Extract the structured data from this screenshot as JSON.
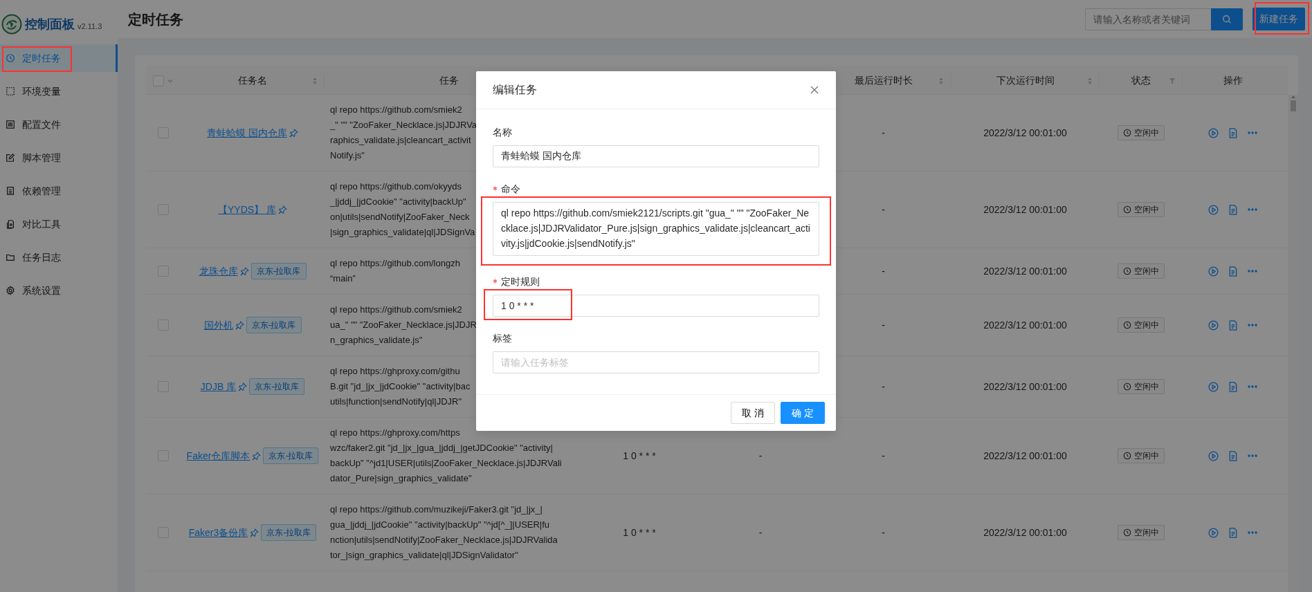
{
  "sidebar": {
    "logo_text": "控制面板",
    "version": "v2.11.3",
    "items": [
      {
        "label": "定时任务",
        "selected": true,
        "highlighted": true
      },
      {
        "label": "环境变量",
        "selected": false,
        "highlighted": false
      },
      {
        "label": "配置文件",
        "selected": false,
        "highlighted": false
      },
      {
        "label": "脚本管理",
        "selected": false,
        "highlighted": false
      },
      {
        "label": "依赖管理",
        "selected": false,
        "highlighted": false
      },
      {
        "label": "对比工具",
        "selected": false,
        "highlighted": false
      },
      {
        "label": "任务日志",
        "selected": false,
        "highlighted": false
      },
      {
        "label": "系统设置",
        "selected": false,
        "highlighted": false
      }
    ]
  },
  "header": {
    "title": "定时任务",
    "search": {
      "placeholder": "请输入名称或者关键词"
    },
    "new_button": {
      "label": "新建任务",
      "highlighted": true
    }
  },
  "table": {
    "select_all": {
      "checked": false
    },
    "columns": [
      {
        "label": "任务名",
        "sortable": true,
        "filterable": false
      },
      {
        "label": "任务",
        "sortable": false,
        "filterable": false
      },
      {
        "label": "最后运行时长",
        "sortable": true,
        "filterable": false
      },
      {
        "label": "下次运行时间",
        "sortable": true,
        "filterable": false
      },
      {
        "label": "状态",
        "sortable": false,
        "filterable": true
      },
      {
        "label": "操作",
        "sortable": false,
        "filterable": false
      }
    ],
    "rows": [
      {
        "checked": false,
        "name": "青蛙蛤蟆 国内仓库",
        "pinned": true,
        "command_lines": [
          "ql repo https://github.com/smiek2",
          "_\" \"\" \"ZooFaker_Necklace.js|JDJRVa",
          "raphics_validate.js|cleancart_activit",
          "Notify.js\""
        ],
        "last_duration": "-",
        "next_run": "2022/3/12 00:01:00",
        "status": "空闲中"
      },
      {
        "checked": false,
        "name": "【YYDS】 库",
        "pinned": true,
        "command_lines": [
          "ql repo https://github.com/okyyds",
          "_|jddj_|jdCookie\" \"activity|backUp\"",
          "on|utils|sendNotify|ZooFaker_Neck",
          "|sign_graphics_validate|ql|JDSignVa"
        ],
        "last_duration": "-",
        "next_run": "2022/3/12 00:01:00",
        "status": "空闲中"
      },
      {
        "checked": false,
        "name": "龙珠仓库",
        "pinned": true,
        "tag": "京东-拉取库",
        "command_lines": [
          "ql repo https://github.com/longzh",
          "“main”"
        ],
        "last_duration": "-",
        "next_run": "2022/3/12 00:01:00",
        "status": "空闲中"
      },
      {
        "checked": false,
        "name": "国外机",
        "pinned": true,
        "tag": "京东-拉取库",
        "command_lines": [
          "ql repo https://github.com/smiek2",
          "ua_\" \"\" \"ZooFaker_Necklace.js|JDJR",
          "n_graphics_validate.js\""
        ],
        "last_duration": "-",
        "next_run": "2022/3/12 00:01:00",
        "status": "空闲中"
      },
      {
        "checked": false,
        "name": "JDJB 库",
        "pinned": true,
        "tag": "京东-拉取库",
        "command_lines": [
          "ql repo https://ghproxy.com/githu",
          "B.git \"jd_|jx_|jdCookie\" \"activity|bac",
          "utils|function|sendNotify|ql|JDJR\""
        ],
        "last_duration": "-",
        "next_run": "2022/3/12 00:01:00",
        "status": "空闲中"
      },
      {
        "checked": false,
        "name": "Faker仓库脚本",
        "pinned": true,
        "tag": "京东-拉取库",
        "command_lines": [
          "ql repo https://ghproxy.com/https",
          "wzc/faker2.git \"jd_|jx_|gua_|jddj_|getJDCookie\" \"activity|",
          "backUp\" \"^jd1|USER|utils|ZooFaker_Necklace.js|JDJRVali",
          "dator_Pure|sign_graphics_validate\""
        ],
        "schedule": "1 0 * * *",
        "column_5": "-",
        "last_duration": "-",
        "next_run": "2022/3/12 00:01:00",
        "status": "空闲中"
      },
      {
        "checked": false,
        "name": "Faker3备份库",
        "pinned": true,
        "tag": "京东-拉取库",
        "command_lines": [
          "ql repo https://github.com/muzikeji/Faker3.git \"jd_|jx_|",
          "gua_|jddj_|jdCookie\" \"activity|backUp\" \"^jd[^_]|USER|fu",
          "nction|utils|sendNotify|ZooFaker_Necklace.js|JDJRValida",
          "tor_|sign_graphics_validate|ql|JDSignValidator\""
        ],
        "schedule": "1 0 * * *",
        "column_5": "-",
        "last_duration": "-",
        "next_run": "2022/3/12 00:01:00",
        "status": "空闲中"
      }
    ]
  },
  "modal": {
    "title": "编辑任务",
    "fields": [
      {
        "kind": "input",
        "label": "名称",
        "required": false,
        "highlighted": false,
        "value": "青蛙蛤蟆 国内仓库"
      },
      {
        "kind": "textarea",
        "label": "命令",
        "required": true,
        "highlighted": true,
        "value": "ql repo https://github.com/smiek2121/scripts.git \"gua_\" \"\" \"ZooFaker_Necklace.js|JDJRValidator_Pure.js|sign_graphics_validate.js|cleancart_activity.js|jdCookie.js|sendNotify.js\""
      },
      {
        "kind": "input",
        "label": "定时规则",
        "required": true,
        "highlighted": true,
        "value": "1 0 * * *"
      },
      {
        "kind": "input",
        "label": "标签",
        "required": false,
        "highlighted": false,
        "placeholder": "请输入任务标签"
      }
    ],
    "buttons": [
      {
        "label": "取 消",
        "primary": false
      },
      {
        "label": "确 定",
        "primary": true
      }
    ]
  }
}
